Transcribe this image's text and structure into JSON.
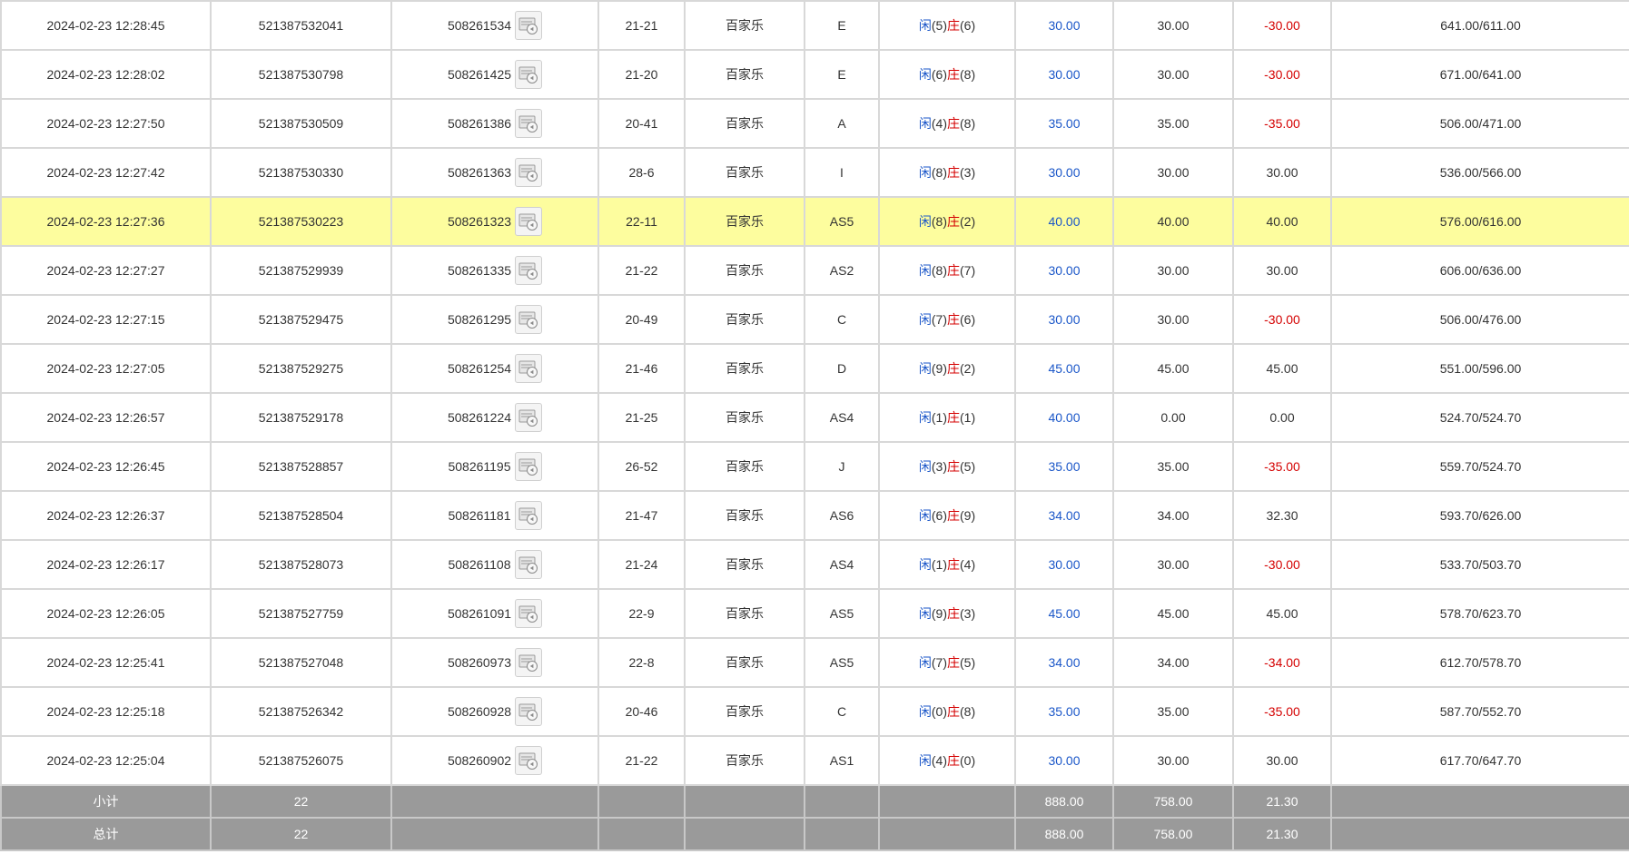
{
  "rows": [
    {
      "time": "2024-02-23 12:28:45",
      "order": "521387532041",
      "game": "508261534",
      "table": "21-21",
      "type": "百家乐",
      "bet": "E",
      "p": "5",
      "b": "6",
      "amount": "30.00",
      "valid": "30.00",
      "win": "-30.00",
      "win_neg": true,
      "balance": "641.00/611.00"
    },
    {
      "time": "2024-02-23 12:28:02",
      "order": "521387530798",
      "game": "508261425",
      "table": "21-20",
      "type": "百家乐",
      "bet": "E",
      "p": "6",
      "b": "8",
      "amount": "30.00",
      "valid": "30.00",
      "win": "-30.00",
      "win_neg": true,
      "balance": "671.00/641.00"
    },
    {
      "time": "2024-02-23 12:27:50",
      "order": "521387530509",
      "game": "508261386",
      "table": "20-41",
      "type": "百家乐",
      "bet": "A",
      "p": "4",
      "b": "8",
      "amount": "35.00",
      "valid": "35.00",
      "win": "-35.00",
      "win_neg": true,
      "balance": "506.00/471.00"
    },
    {
      "time": "2024-02-23 12:27:42",
      "order": "521387530330",
      "game": "508261363",
      "table": "28-6",
      "type": "百家乐",
      "bet": "I",
      "p": "8",
      "b": "3",
      "amount": "30.00",
      "valid": "30.00",
      "win": "30.00",
      "win_neg": false,
      "balance": "536.00/566.00"
    },
    {
      "time": "2024-02-23 12:27:36",
      "order": "521387530223",
      "game": "508261323",
      "table": "22-11",
      "type": "百家乐",
      "bet": "AS5",
      "p": "8",
      "b": "2",
      "amount": "40.00",
      "valid": "40.00",
      "win": "40.00",
      "win_neg": false,
      "balance": "576.00/616.00",
      "highlight": true
    },
    {
      "time": "2024-02-23 12:27:27",
      "order": "521387529939",
      "game": "508261335",
      "table": "21-22",
      "type": "百家乐",
      "bet": "AS2",
      "p": "8",
      "b": "7",
      "amount": "30.00",
      "valid": "30.00",
      "win": "30.00",
      "win_neg": false,
      "balance": "606.00/636.00"
    },
    {
      "time": "2024-02-23 12:27:15",
      "order": "521387529475",
      "game": "508261295",
      "table": "20-49",
      "type": "百家乐",
      "bet": "C",
      "p": "7",
      "b": "6",
      "amount": "30.00",
      "valid": "30.00",
      "win": "-30.00",
      "win_neg": true,
      "balance": "506.00/476.00"
    },
    {
      "time": "2024-02-23 12:27:05",
      "order": "521387529275",
      "game": "508261254",
      "table": "21-46",
      "type": "百家乐",
      "bet": "D",
      "p": "9",
      "b": "2",
      "amount": "45.00",
      "valid": "45.00",
      "win": "45.00",
      "win_neg": false,
      "balance": "551.00/596.00"
    },
    {
      "time": "2024-02-23 12:26:57",
      "order": "521387529178",
      "game": "508261224",
      "table": "21-25",
      "type": "百家乐",
      "bet": "AS4",
      "p": "1",
      "b": "1",
      "amount": "40.00",
      "valid": "0.00",
      "win": "0.00",
      "win_neg": false,
      "balance": "524.70/524.70"
    },
    {
      "time": "2024-02-23 12:26:45",
      "order": "521387528857",
      "game": "508261195",
      "table": "26-52",
      "type": "百家乐",
      "bet": "J",
      "p": "3",
      "b": "5",
      "amount": "35.00",
      "valid": "35.00",
      "win": "-35.00",
      "win_neg": true,
      "balance": "559.70/524.70"
    },
    {
      "time": "2024-02-23 12:26:37",
      "order": "521387528504",
      "game": "508261181",
      "table": "21-47",
      "type": "百家乐",
      "bet": "AS6",
      "p": "6",
      "b": "9",
      "amount": "34.00",
      "valid": "34.00",
      "win": "32.30",
      "win_neg": false,
      "balance": "593.70/626.00"
    },
    {
      "time": "2024-02-23 12:26:17",
      "order": "521387528073",
      "game": "508261108",
      "table": "21-24",
      "type": "百家乐",
      "bet": "AS4",
      "p": "1",
      "b": "4",
      "amount": "30.00",
      "valid": "30.00",
      "win": "-30.00",
      "win_neg": true,
      "balance": "533.70/503.70"
    },
    {
      "time": "2024-02-23 12:26:05",
      "order": "521387527759",
      "game": "508261091",
      "table": "22-9",
      "type": "百家乐",
      "bet": "AS5",
      "p": "9",
      "b": "3",
      "amount": "45.00",
      "valid": "45.00",
      "win": "45.00",
      "win_neg": false,
      "balance": "578.70/623.70"
    },
    {
      "time": "2024-02-23 12:25:41",
      "order": "521387527048",
      "game": "508260973",
      "table": "22-8",
      "type": "百家乐",
      "bet": "AS5",
      "p": "7",
      "b": "5",
      "amount": "34.00",
      "valid": "34.00",
      "win": "-34.00",
      "win_neg": true,
      "balance": "612.70/578.70"
    },
    {
      "time": "2024-02-23 12:25:18",
      "order": "521387526342",
      "game": "508260928",
      "table": "20-46",
      "type": "百家乐",
      "bet": "C",
      "p": "0",
      "b": "8",
      "amount": "35.00",
      "valid": "35.00",
      "win": "-35.00",
      "win_neg": true,
      "balance": "587.70/552.70"
    },
    {
      "time": "2024-02-23 12:25:04",
      "order": "521387526075",
      "game": "508260902",
      "table": "21-22",
      "type": "百家乐",
      "bet": "AS1",
      "p": "4",
      "b": "0",
      "amount": "30.00",
      "valid": "30.00",
      "win": "30.00",
      "win_neg": false,
      "balance": "617.70/647.70"
    }
  ],
  "labels": {
    "player": "闲",
    "banker": "庄"
  },
  "subtotal": {
    "label": "小计",
    "count": "22",
    "amount": "888.00",
    "valid": "758.00",
    "win": "21.30"
  },
  "total": {
    "label": "总计",
    "count": "22",
    "amount": "888.00",
    "valid": "758.00",
    "win": "21.30"
  },
  "colors": {
    "blue": "#1a56c8",
    "red": "#d40000",
    "highlight": "#fdfd9e",
    "summary_bg": "#9a9a9a"
  }
}
